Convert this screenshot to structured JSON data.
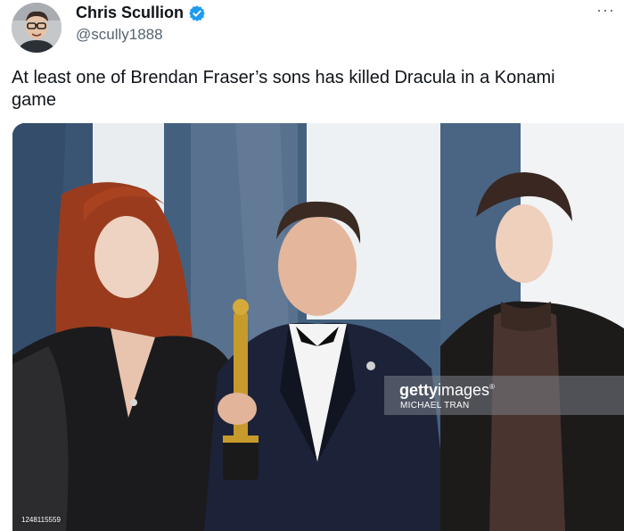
{
  "author": {
    "display_name": "Chris Scullion",
    "handle": "@scully1888",
    "verified": true
  },
  "menu_icon": "more-horizontal-icon",
  "tweet": {
    "text": "At least one of Brendan Fraser’s sons has killed Dracula in a Konami game"
  },
  "media": {
    "watermark_brand_bold": "getty",
    "watermark_brand_light": "images",
    "watermark_registered": "®",
    "watermark_credit": "MICHAEL TRAN",
    "image_id": "1248115559"
  },
  "colors": {
    "text_primary": "#0f1419",
    "text_secondary": "#536471",
    "verified_blue": "#1d9bf0"
  }
}
